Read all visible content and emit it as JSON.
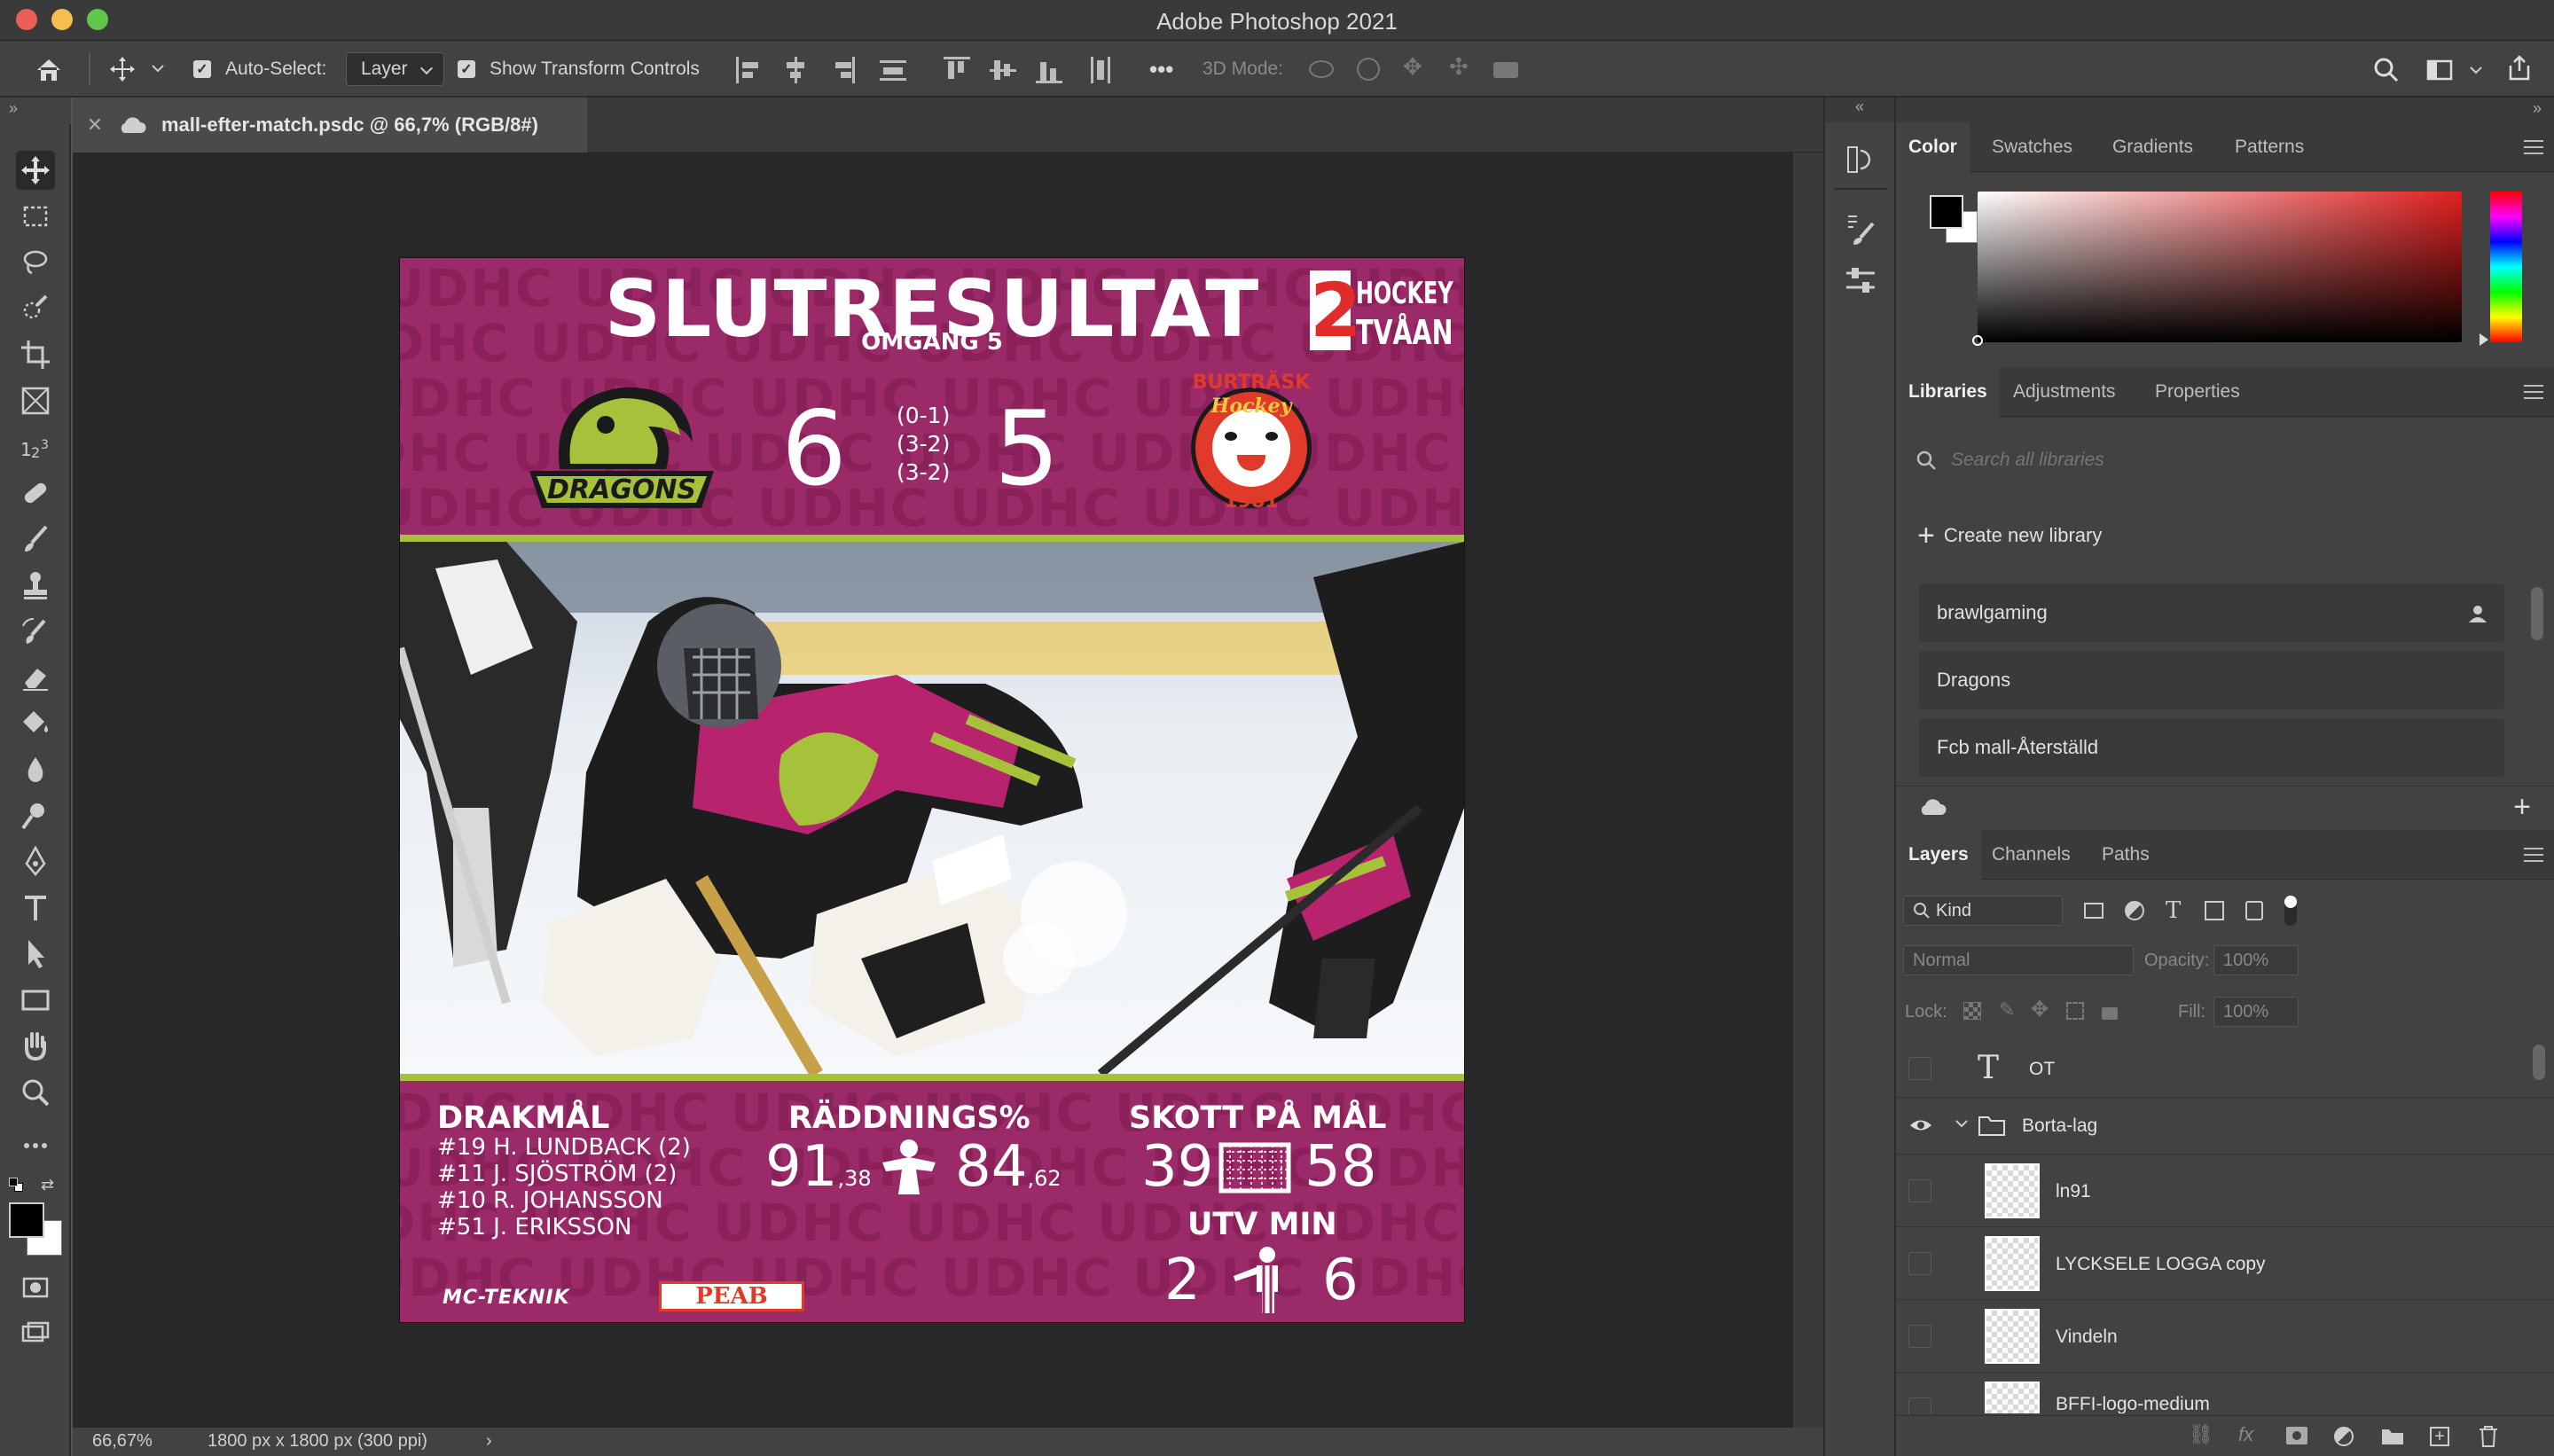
{
  "app": {
    "title": "Adobe Photoshop 2021"
  },
  "options_bar": {
    "auto_select_label": "Auto-Select:",
    "auto_select_value": "Layer",
    "show_transform_label": "Show Transform Controls",
    "more_label": "•••",
    "mode_3d_label": "3D Mode:"
  },
  "document": {
    "tab_title": "mall-efter-match.psdc @ 66,7% (RGB/8#)",
    "close_glyph": "✕"
  },
  "status": {
    "zoom": "66,67%",
    "doc_size": "1800 px x 1800 px (300 ppi)",
    "arrow": "›"
  },
  "artwork": {
    "headline": "SLUTRESULTAT",
    "round": "OMGÅNG 5",
    "league_number": "2",
    "league_name_1": "HOCKEY",
    "league_name_2": "TVÅAN",
    "home_score": "6",
    "away_score": "5",
    "periods": [
      "(0-1)",
      "(3-2)",
      "(3-2)"
    ],
    "home_team_logo_text": "DRAGONS",
    "away_team_logo_text_1": "BURTRÄSK",
    "away_team_logo_text_2": "Hockey",
    "away_team_logo_year": "1981",
    "watermark": "UDHC UDHC UDHC UDHC UDHC UDHC",
    "goals_heading": "DRAKMÅL",
    "scorers": [
      "#19 H. LUNDBACK (2)",
      "#11 J. SJÖSTRÖM (2)",
      "#10 R. JOHANSSON",
      "#51 J. ERIKSSON"
    ],
    "saves_heading": "RÄDDNINGS%",
    "saves_home": "91",
    "saves_home_dec": ",38",
    "saves_away": "84",
    "saves_away_dec": ",62",
    "shots_heading": "SKOTT PÅ MÅL",
    "shots_home": "39",
    "shots_away": "58",
    "pim_heading": "UTV MIN",
    "pim_home": "2",
    "pim_away": "6",
    "sponsor_1": "MC-TEKNIK",
    "sponsor_2": "PEAB",
    "colors": {
      "background": "#9b2a69",
      "accent": "#a6c13a"
    }
  },
  "color_panel": {
    "tabs": [
      "Color",
      "Swatches",
      "Gradients",
      "Patterns"
    ],
    "active_tab": "Color",
    "foreground": "#000000",
    "background": "#ffffff",
    "hue_color": "#e0201f"
  },
  "libraries_panel": {
    "tabs": [
      "Libraries",
      "Adjustments",
      "Properties"
    ],
    "search_placeholder": "Search all libraries",
    "create_label": "Create new library",
    "items": [
      "brawlgaming",
      "Dragons",
      "Fcb mall-Återställd"
    ]
  },
  "layers_panel": {
    "tabs": [
      "Layers",
      "Channels",
      "Paths"
    ],
    "filter_kind": "Kind",
    "blend_mode": "Normal",
    "opacity_label": "Opacity:",
    "opacity_value": "100%",
    "lock_label": "Lock:",
    "fill_label": "Fill:",
    "fill_value": "100%",
    "layers": [
      {
        "name": "OT",
        "type": "text",
        "visible": false
      },
      {
        "name": "Borta-lag",
        "type": "group",
        "visible": true
      },
      {
        "name": "ln91",
        "type": "image",
        "visible": false
      },
      {
        "name": "LYCKSELE LOGGA copy",
        "type": "image",
        "visible": false
      },
      {
        "name": "Vindeln",
        "type": "image",
        "visible": false
      },
      {
        "name": "BFFI-logo-medium",
        "type": "image",
        "visible": false
      }
    ]
  }
}
